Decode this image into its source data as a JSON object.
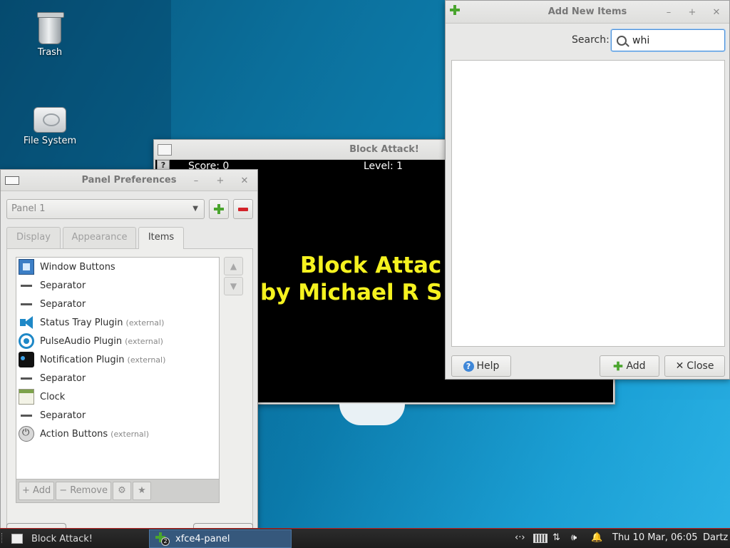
{
  "desktop": {
    "icons": [
      {
        "label": "Trash",
        "icon": "trash-icon"
      },
      {
        "label": "File System",
        "icon": "drive-icon"
      }
    ]
  },
  "block_attack": {
    "title": "Block Attack!",
    "score_text": "Score: 0",
    "level_text": "Level: 1",
    "help_glyph": "?",
    "banner_line1": "Block Attac",
    "banner_line2": "by Michael R S"
  },
  "panel_prefs": {
    "title": "Panel Preferences",
    "panel_select": "Panel 1",
    "tabs": [
      "Display",
      "Appearance",
      "Items"
    ],
    "active_tab": "Items",
    "items": [
      {
        "name": "Window Buttons",
        "ext": "",
        "icon": "window-buttons-icon"
      },
      {
        "name": "Separator",
        "ext": "",
        "icon": "separator-icon"
      },
      {
        "name": "Separator",
        "ext": "",
        "icon": "separator-icon"
      },
      {
        "name": "Status Tray Plugin",
        "ext": "(external)",
        "icon": "megaphone-icon"
      },
      {
        "name": "PulseAudio Plugin",
        "ext": "(external)",
        "icon": "audio-icon"
      },
      {
        "name": "Notification Plugin",
        "ext": "(external)",
        "icon": "notification-icon"
      },
      {
        "name": "Separator",
        "ext": "",
        "icon": "separator-icon"
      },
      {
        "name": "Clock",
        "ext": "",
        "icon": "calendar-icon"
      },
      {
        "name": "Separator",
        "ext": "",
        "icon": "separator-icon"
      },
      {
        "name": "Action Buttons",
        "ext": "(external)",
        "icon": "power-icon"
      }
    ],
    "toolbar": {
      "add_label": "+ Add",
      "remove_label": "− Remove",
      "settings_glyph": "⚙",
      "about_glyph": "★"
    }
  },
  "add_items": {
    "title": "Add New Items",
    "search_label": "Search:",
    "search_value": "whi",
    "help_label": "Help",
    "add_label": "Add",
    "close_label": "Close"
  },
  "taskbar": {
    "tasks": [
      "Block Attack!",
      "xfce4-panel"
    ],
    "task_badge": "2",
    "clock": "Thu 10 Mar, 06:05",
    "user": "Dartz"
  },
  "colors": {
    "accent": "#4a90d9",
    "taskbar_border": "#b92020",
    "banner_text": "#f5f21f"
  }
}
